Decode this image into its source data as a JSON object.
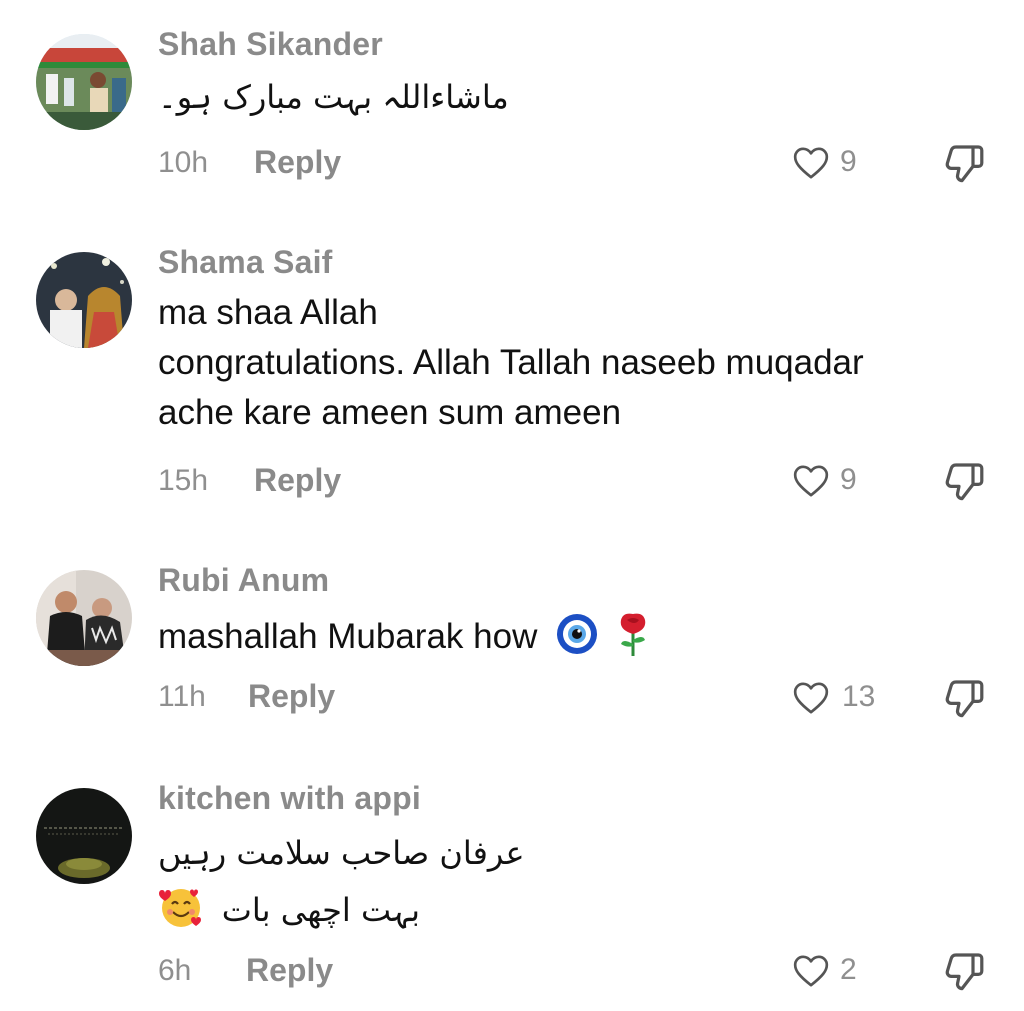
{
  "comments": [
    {
      "username": "Shah Sikander",
      "lines": [
        "ماشاءاللہ بہت مبارک ہو۔"
      ],
      "time": "10h",
      "reply_label": "Reply",
      "likes": "9"
    },
    {
      "username": "Shama Saif",
      "lines": [
        "ma shaa Allah",
        "congratulations. Allah Tallah naseeb muqadar",
        "ache kare ameen sum ameen"
      ],
      "time": "15h",
      "reply_label": "Reply",
      "likes": "9"
    },
    {
      "username": "Rubi Anum",
      "lines": [
        "mashallah Mubarak how"
      ],
      "emojis": [
        "nazar-amulet",
        "rose"
      ],
      "time": "11h",
      "reply_label": "Reply",
      "likes": "13"
    },
    {
      "username": "kitchen with appi",
      "lines": [
        "عرفان صاحب سلامت رہیں",
        "بہت اچھی بات"
      ],
      "emojis": [
        "smiling-face-with-hearts"
      ],
      "time": "6h",
      "reply_label": "Reply",
      "likes": "2"
    }
  ],
  "icons": {
    "like": "heart-outline-icon",
    "dislike": "thumbs-down-outline-icon"
  },
  "colors": {
    "secondary_text": "#8a8a8a",
    "primary_text": "#111111",
    "background": "#ffffff"
  }
}
